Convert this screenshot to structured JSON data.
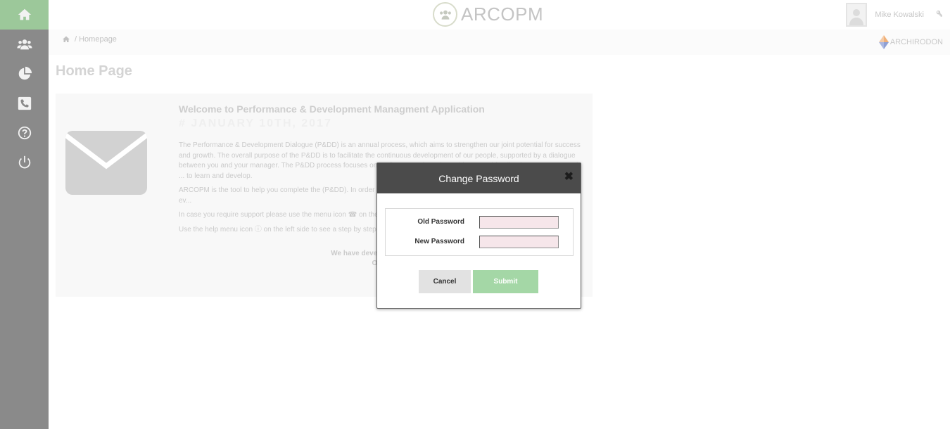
{
  "sidebar": {
    "items": [
      {
        "name": "home",
        "icon": "home-icon",
        "active": true
      },
      {
        "name": "employees",
        "icon": "users-icon",
        "active": false
      },
      {
        "name": "reports",
        "icon": "pie-chart-icon",
        "active": false
      },
      {
        "name": "contact",
        "icon": "phone-icon",
        "active": false
      },
      {
        "name": "help",
        "icon": "question-icon",
        "active": false
      },
      {
        "name": "logout",
        "icon": "power-icon",
        "active": false
      }
    ]
  },
  "header": {
    "app_name": "ARCOPM",
    "user_name": "Mike  Kowalski",
    "partner": "ARCHIRODON"
  },
  "breadcrumb": {
    "path": "/ Homepage"
  },
  "page": {
    "title": "Home Page"
  },
  "welcome": {
    "heading": "Welcome to Performance & Development Managment Application",
    "date": "# JANUARY 10TH, 2017",
    "paragraph1": "The Performance & Development Dialogue (P&DD) is an annual process, which aims to strengthen our joint potential for success and growth. The overall purpose of the P&DD is to facilitate the continuous development of our people, supported by a dialogue between you and your manager. The P&DD process focuses on ... discuss and receive guidance and feedback on your personal ... to learn and develop.",
    "paragraph2": "ARCOPM is the tool to help you complete the (P&DD). In order ... menu 👥, where you shall see all the employees you need to ev...",
    "paragraph3": "In case you require support please use the menu icon ☎ on the ...",
    "paragraph4": "Use the help menu icon ⓘ on the left side to see a step by step ...",
    "closing_line1": "We have developed this tool ...",
    "closing_line2": "Our ..."
  },
  "modal": {
    "title": "Change Password",
    "close_label": "✖",
    "old_password_label": "Old Password",
    "new_password_label": "New Password",
    "old_password_value": "",
    "new_password_value": "",
    "cancel_label": "Cancel",
    "submit_label": "Submit"
  },
  "colors": {
    "sidebar_bg": "#8a8a8a",
    "sidebar_active": "#9cc89a",
    "modal_header": "#4b4b4b",
    "submit_button": "#a4d7a6",
    "input_bg": "#f6e6ea"
  }
}
